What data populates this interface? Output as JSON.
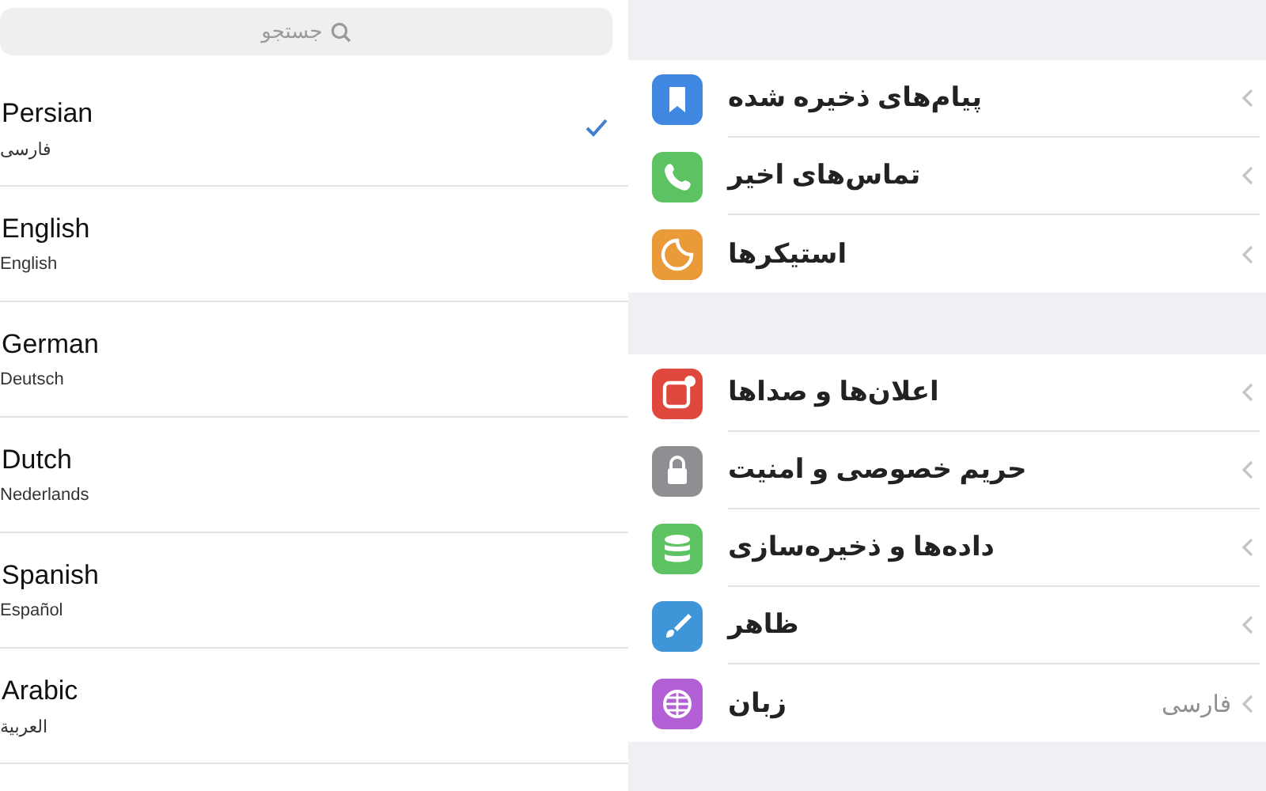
{
  "search": {
    "placeholder": "جستجو"
  },
  "languages": [
    {
      "name": "Persian",
      "native": "فارسی",
      "selected": true
    },
    {
      "name": "English",
      "native": "English",
      "selected": false
    },
    {
      "name": "German",
      "native": "Deutsch",
      "selected": false
    },
    {
      "name": "Dutch",
      "native": "Nederlands",
      "selected": false
    },
    {
      "name": "Spanish",
      "native": "Español",
      "selected": false
    },
    {
      "name": "Arabic",
      "native": "العربية",
      "selected": false
    }
  ],
  "settings_groups": [
    {
      "items": [
        {
          "label": "پیام‌های ذخیره شده",
          "kind": "bookmark",
          "color": "#3f87e0"
        },
        {
          "label": "تماس‌های اخیر",
          "kind": "phone",
          "color": "#5cc262"
        },
        {
          "label": "استیکرها",
          "kind": "sticker",
          "color": "#eb9a3a"
        }
      ]
    },
    {
      "items": [
        {
          "label": "اعلان‌ها و صداها",
          "kind": "notification",
          "color": "#e0483e"
        },
        {
          "label": "حریم خصوصی و امنیت",
          "kind": "lock",
          "color": "#8e8e93"
        },
        {
          "label": "داده‌ها و ذخیره‌سازی",
          "kind": "data",
          "color": "#5cc262"
        },
        {
          "label": "ظاهر",
          "kind": "brush",
          "color": "#3e95d8"
        },
        {
          "label": "زبان",
          "kind": "globe",
          "color": "#b35fd6",
          "value": "فارسی"
        }
      ]
    }
  ]
}
